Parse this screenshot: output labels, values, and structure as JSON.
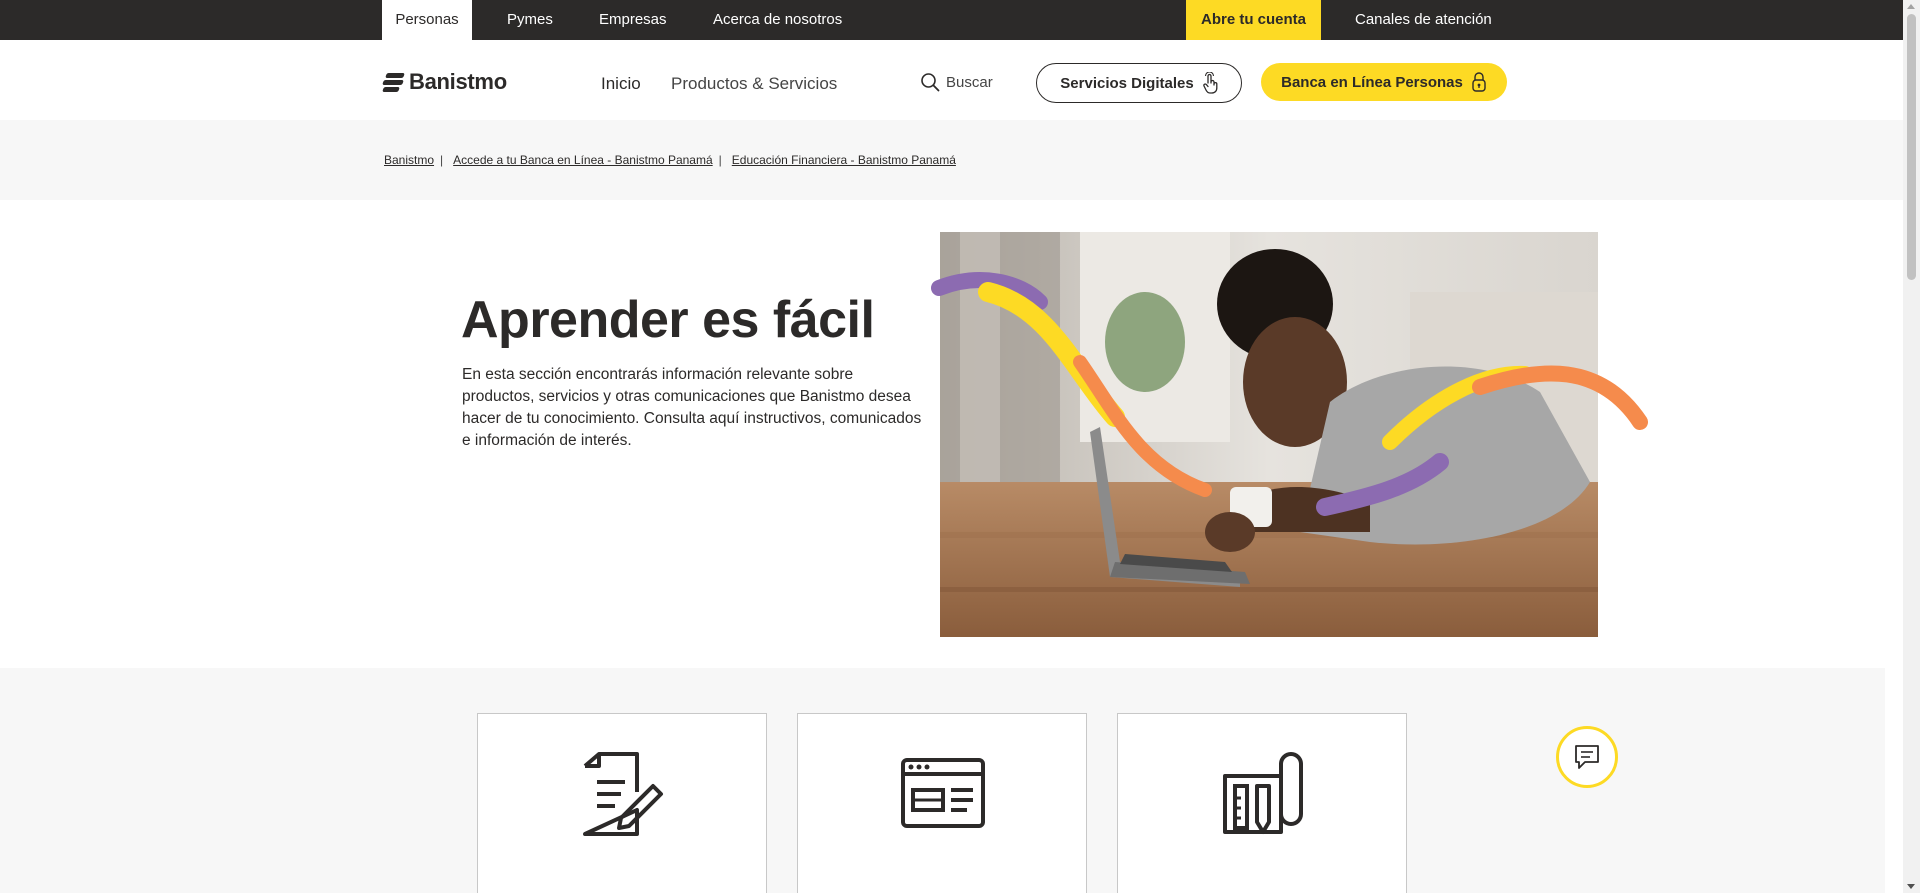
{
  "topbar": {
    "tabs": [
      {
        "label": "Personas"
      },
      {
        "label": "Pymes"
      },
      {
        "label": "Empresas"
      },
      {
        "label": "Acerca de nosotros"
      }
    ],
    "open_account": "Abre tu cuenta",
    "channels": "Canales de atención"
  },
  "header": {
    "logo_text": "Banistmo",
    "nav": [
      {
        "label": "Inicio"
      },
      {
        "label": "Productos & Servicios"
      }
    ],
    "search_label": "Buscar",
    "digital_services": "Servicios Digitales",
    "online_banking": "Banca en Línea Personas"
  },
  "breadcrumb": [
    {
      "label": "Banistmo"
    },
    {
      "label": "Accede a tu Banca en Línea - Banistmo Panamá"
    },
    {
      "label": "Educación Financiera - Banistmo Panamá"
    }
  ],
  "hero": {
    "title": "Aprender es fácil",
    "text": "En esta sección encontrarás información relevante sobre productos, servicios y otras comunicaciones que Banistmo desea hacer de tu conocimiento. Consulta aquí instructivos, comunicados e información de interés."
  },
  "cards": [
    {
      "icon": "document-edit-icon"
    },
    {
      "icon": "browser-window-icon"
    },
    {
      "icon": "blueprint-tools-icon"
    }
  ],
  "colors": {
    "brand_yellow": "#fdda24",
    "dark": "#2c2a29",
    "ribbon_purple": "#8c6bb1",
    "ribbon_orange": "#f58b4c"
  }
}
